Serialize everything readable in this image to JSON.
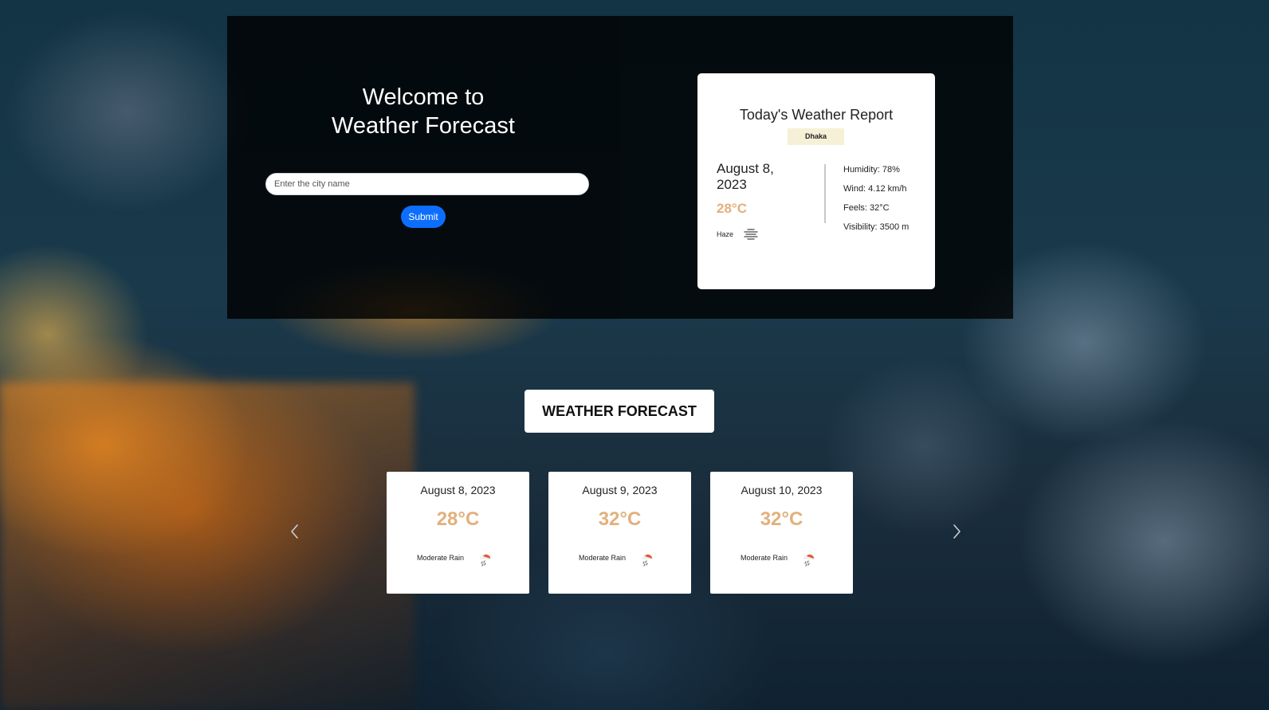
{
  "hero": {
    "title_line1": "Welcome to",
    "title_line2": "Weather Forecast",
    "search_placeholder": "Enter the city name",
    "submit_label": "Submit"
  },
  "report": {
    "title": "Today's Weather Report",
    "city": "Dhaka",
    "date": "August 8, 2023",
    "temperature": "28°C",
    "condition": "Haze",
    "condition_icon": "haze-icon",
    "humidity": "Humidity: 78%",
    "wind": "Wind: 4.12 km/h",
    "feels": "Feels: 32°C",
    "visibility": "Visibility: 3500 m"
  },
  "forecast": {
    "title": "WEATHER FORECAST",
    "prev_icon": "chevron-left-icon",
    "next_icon": "chevron-right-icon",
    "cards": [
      {
        "date": "August 8, 2023",
        "temperature": "28°C",
        "condition": "Moderate Rain",
        "icon": "rain-icon"
      },
      {
        "date": "August 9, 2023",
        "temperature": "32°C",
        "condition": "Moderate Rain",
        "icon": "rain-icon"
      },
      {
        "date": "August 10, 2023",
        "temperature": "32°C",
        "condition": "Moderate Rain",
        "icon": "rain-icon"
      }
    ]
  },
  "colors": {
    "accent_blue": "#0d6efd",
    "temperature": "#e2b07c",
    "city_badge_bg": "#f6f1d6"
  }
}
